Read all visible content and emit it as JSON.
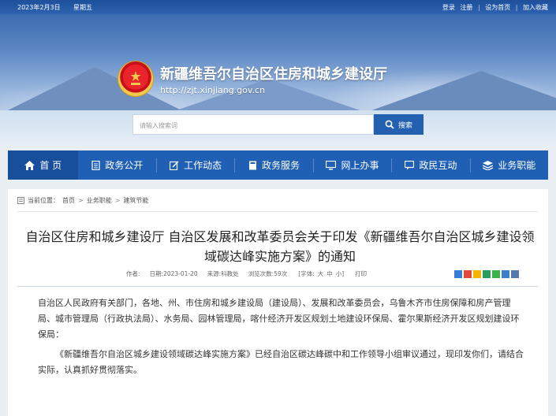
{
  "topbar": {
    "date": "2023年2月3日",
    "weekday": "星期五",
    "login": "登录",
    "register": "注册",
    "set_home": "设为首页",
    "favorite": "加入收藏"
  },
  "site": {
    "title": "新疆维吾尔自治区住房和城乡建设厅",
    "url": "http://zjt.xinjiang.gov.cn"
  },
  "search": {
    "placeholder": "请输入搜索词",
    "button_label": "搜索"
  },
  "nav": {
    "items": [
      {
        "label": "首 页",
        "icon": "home-icon"
      },
      {
        "label": "政务公开",
        "icon": "document-icon"
      },
      {
        "label": "工作动态",
        "icon": "edit-icon"
      },
      {
        "label": "政务服务",
        "icon": "notebook-icon"
      },
      {
        "label": "网上办事",
        "icon": "monitor-icon"
      },
      {
        "label": "政民互动",
        "icon": "chat-icon"
      },
      {
        "label": "业务职能",
        "icon": "stack-icon"
      }
    ]
  },
  "breadcrumb": {
    "prefix": "当前位置：",
    "items": [
      "首页",
      "业务职能",
      "建筑节能"
    ],
    "separator": ">"
  },
  "article": {
    "title": "自治区住房和城乡建设厅 自治区发展和改革委员会关于印发《新疆维吾尔自治区城乡建设领域碳达峰实施方案》的通知",
    "author_label": "作者:",
    "date_label": "日期:",
    "date": "2023-01-20",
    "source_label": "来源:",
    "source": "科教处",
    "views_label": "浏览次数:",
    "views": "59次",
    "font_label": "[字体:",
    "font_large": "大",
    "font_medium": "中",
    "font_small": "小]",
    "print": "打印",
    "paragraph1": "自治区人民政府有关部门，各地、州、市住房和城乡建设局（建设局）、发展和改革委员会，乌鲁木齐市住房保障和房产管理局、城市管理局（行政执法局）、水务局、园林管理局，喀什经济开发区规划土地建设环保局、霍尔果斯经济开发区规划建设环保局：",
    "paragraph2": "《新疆维吾尔自治区城乡建设领域碳达峰实施方案》已经自治区碳达峰碳中和工作领导小组审议通过，现印发你们，请结合实际，认真抓好贯彻落实。"
  },
  "colors": {
    "nav_bg": "#1f5fb4",
    "nav_home_bg": "#174f9c",
    "search_button": "#2360b0"
  }
}
